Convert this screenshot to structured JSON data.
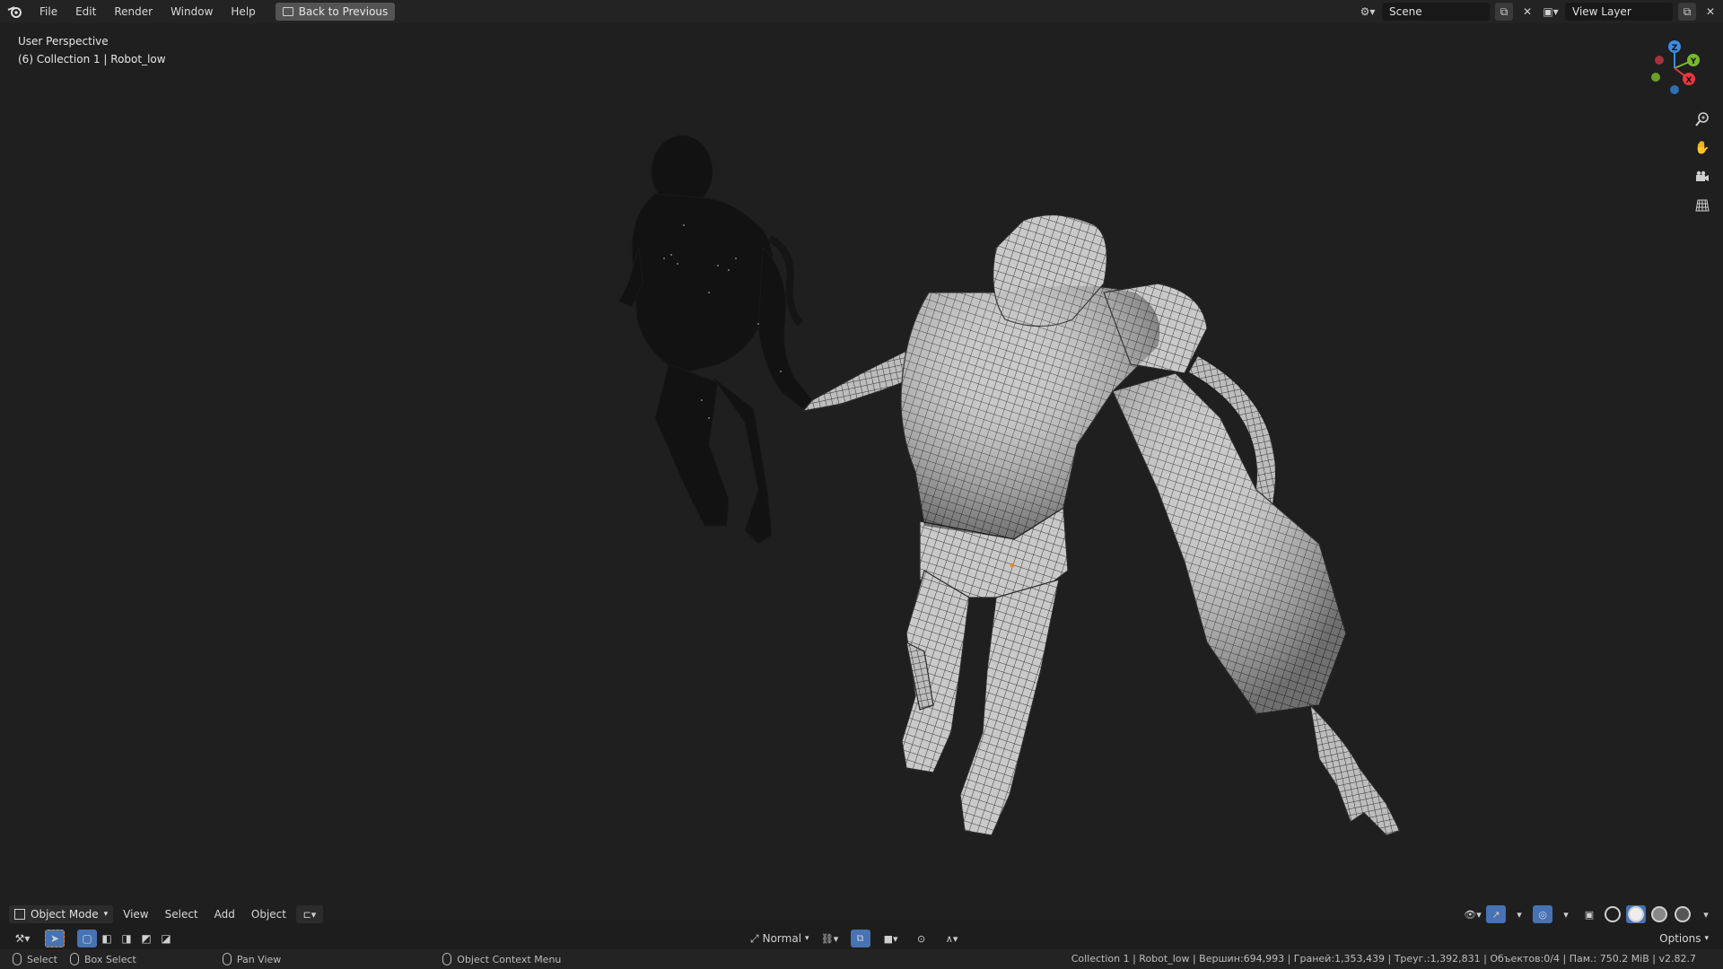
{
  "menu": {
    "items": [
      "File",
      "Edit",
      "Render",
      "Window",
      "Help"
    ],
    "back_label": "Back to Previous"
  },
  "topright": {
    "scene": "Scene",
    "view_layer": "View Layer"
  },
  "viewport": {
    "perspective": "User Perspective",
    "collection": "(6) Collection 1 | Robot_low",
    "gizmo": {
      "z": "Z",
      "y": "Y",
      "x": "X"
    }
  },
  "header": {
    "mode": "Object Mode",
    "items": [
      "View",
      "Select",
      "Add",
      "Object"
    ]
  },
  "toolbar": {
    "pivot": "Normal",
    "options": "Options"
  },
  "status": {
    "select": "Select",
    "box_select": "Box Select",
    "pan_view": "Pan View",
    "context_menu": "Object Context Menu",
    "stats": "Collection 1 | Robot_low | Вершин:694,993 | Граней:1,353,439 | Треуг.:1,392,831 | Объектов:0/4 | Пам.: 750.2 MiB | v2.82.7"
  },
  "icons": {
    "logo": "blender-logo-icon",
    "zoom": "zoom-icon",
    "pan": "hand-icon",
    "camera": "camera-icon",
    "grid": "grid-icon"
  },
  "colors": {
    "accent": "#4772b3",
    "axis_x": "#e8373d",
    "axis_y": "#7ab92a",
    "axis_z": "#3b8ce3"
  }
}
